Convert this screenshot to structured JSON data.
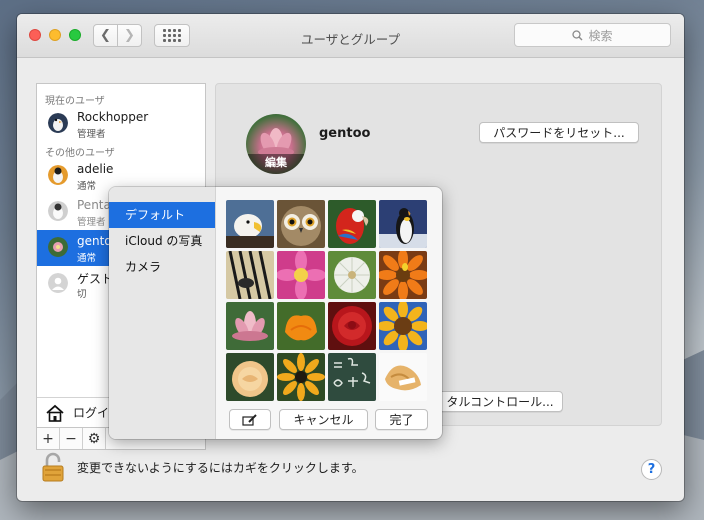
{
  "window": {
    "title": "ユーザとグループ"
  },
  "search": {
    "placeholder": "検索"
  },
  "users": {
    "current_header": "現在のユーザ",
    "current": {
      "name": "Rockhopper",
      "role": "管理者"
    },
    "others_header": "その他のユーザ",
    "others": [
      {
        "name": "adelie",
        "role": "通常"
      },
      {
        "name": "Penta",
        "role": "管理者"
      },
      {
        "name": "gento",
        "role": "通常"
      },
      {
        "name": "ゲスト",
        "role": "切"
      }
    ],
    "login_options": "ログイ"
  },
  "detail": {
    "username": "gentoo",
    "edit_label": "編集",
    "reset_password": "パスワードをリセット...",
    "parental_controls": "タルコントロール..."
  },
  "lock": {
    "text": "変更できないようにするにはカギをクリックします。"
  },
  "help": {
    "label": "?"
  },
  "popover": {
    "sources": [
      "デフォルト",
      "iCloud の写真",
      "カメラ"
    ],
    "selected_source": "デフォルト",
    "images": [
      "eagle",
      "owl",
      "parrot",
      "penguin",
      "zebra",
      "pink-flower",
      "dandelion",
      "orange-flower",
      "lotus",
      "poppy",
      "red-rose",
      "sunflower",
      "yellow-rose",
      "black-eyed-susan",
      "chalkboard",
      "fortune-cookie"
    ],
    "cancel": "キャンセル",
    "done": "完了"
  },
  "listbuttons": {
    "add": "+",
    "remove": "−"
  },
  "colors": {
    "accent": "#1d6fe0"
  }
}
